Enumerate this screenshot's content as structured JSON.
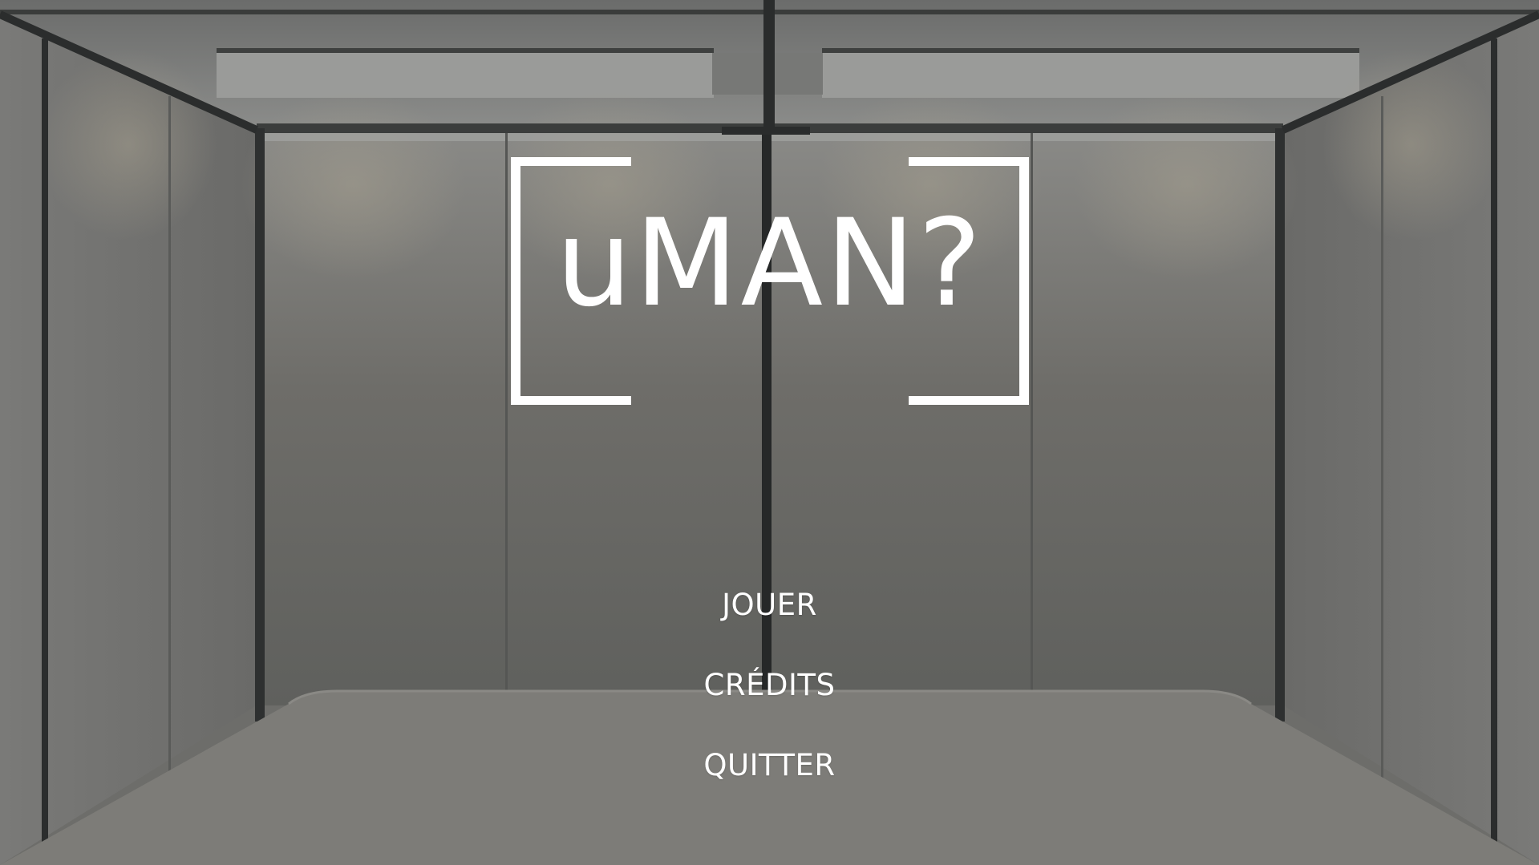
{
  "game": {
    "logo_text": "uMAN?",
    "menu": {
      "play": "JOUER",
      "credits": "CRÉDITS",
      "quit": "QUITTER"
    }
  },
  "colors": {
    "text": "#ffffff",
    "floor": "#7d7c78",
    "wall": "#6d6d6a",
    "frame": "#2b2d2d"
  }
}
